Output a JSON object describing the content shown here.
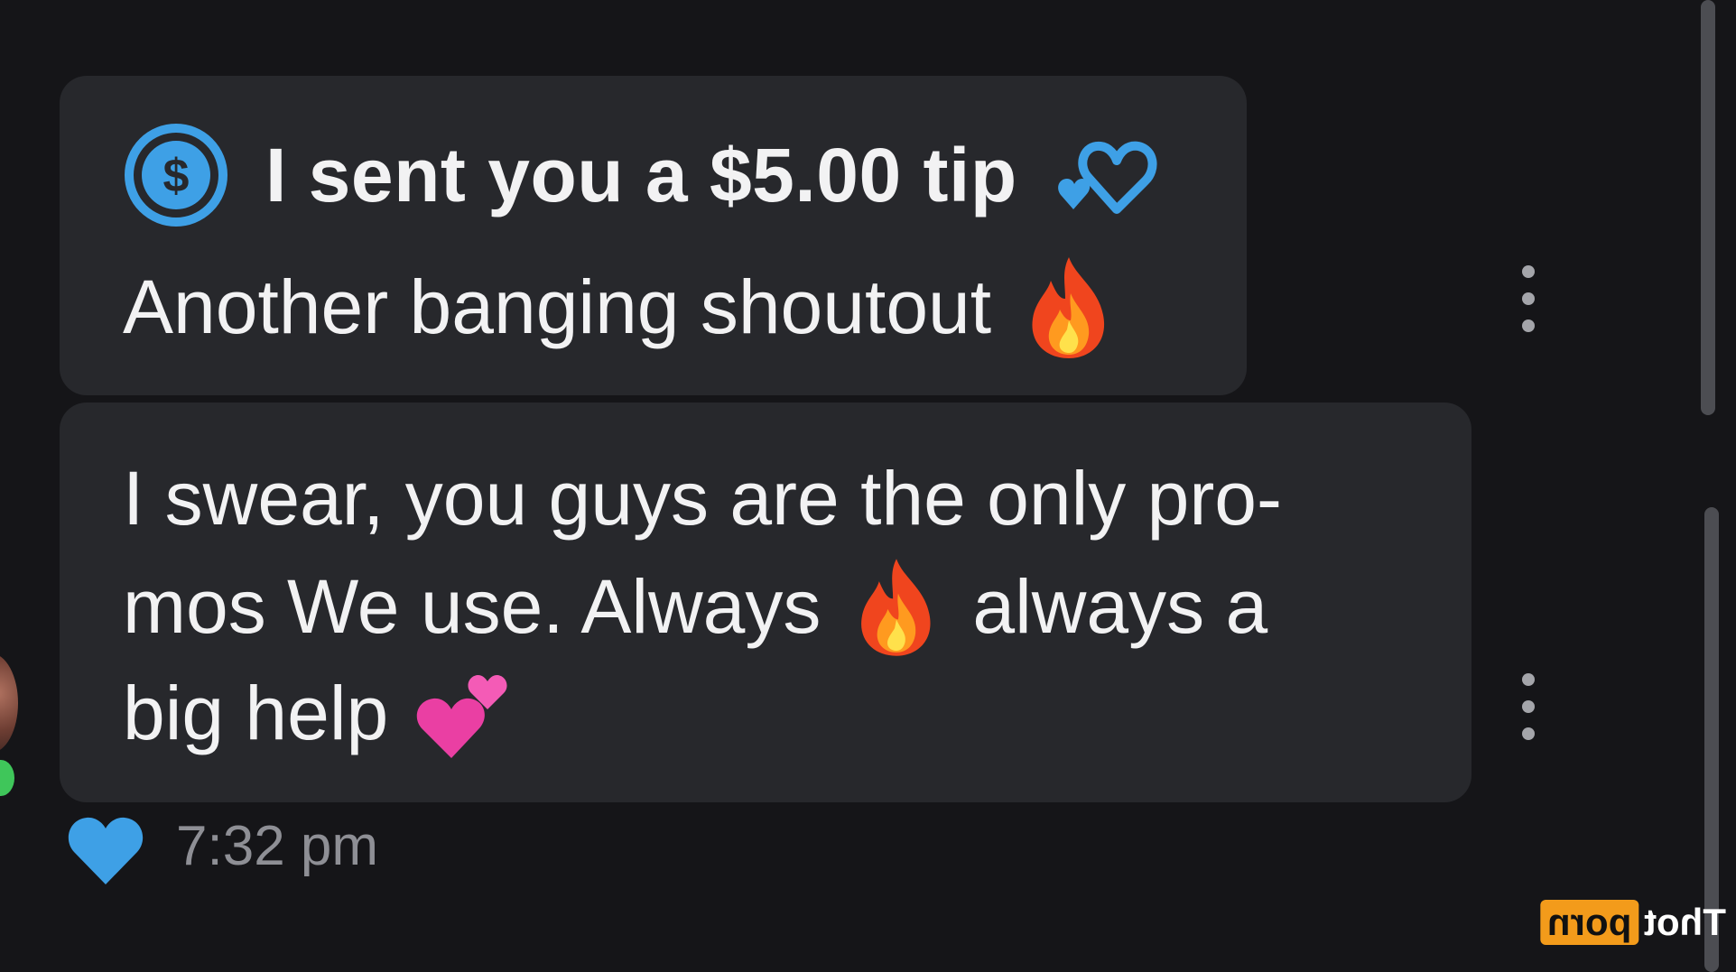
{
  "messages": [
    {
      "tip_text": "I sent you a $5.00 tip",
      "text": "Another banging shoutout"
    },
    {
      "line1": "I swear, you guys are the only pro-",
      "line2a": "mos We use. Always",
      "line2b": "always a",
      "line3": "big help"
    }
  ],
  "footer": {
    "timestamp": "7:32 pm"
  },
  "watermark": {
    "box": "porn",
    "text": "Thot"
  },
  "icons": {
    "dollar": "dollar-circle-icon",
    "tip_hearts": "revolving-hearts-icon",
    "fire": "fire-icon",
    "two_hearts": "two-hearts-icon",
    "like": "heart-icon",
    "more": "more-vertical-icon"
  },
  "colors": {
    "accent_blue": "#3ea0e6",
    "bubble_bg": "#27282c",
    "background": "#151518",
    "timestamp": "#8e8f95",
    "online": "#3fc65a",
    "watermark_orange": "#f39b1b"
  }
}
